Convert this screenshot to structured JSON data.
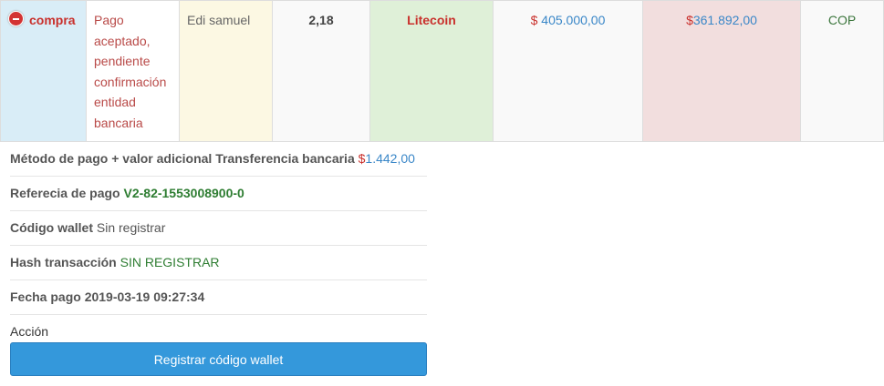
{
  "order": {
    "type": "compra",
    "status": "Pago aceptado, pendiente confirmación entidad bancaria",
    "user": "Edi samuel",
    "amount": "2,18",
    "coin": "Litecoin",
    "price_symbol": "$",
    "price_value": " 405.000,00",
    "total_symbol": "$",
    "total_value": "361.892,00",
    "currency": "COP"
  },
  "details": {
    "payment_method_label": "Método de pago + valor adicional Transferencia bancaria",
    "payment_method_symbol": "$",
    "payment_method_value": "1.442,00",
    "reference_label": "Referecia de pago",
    "reference_value": "V2-82-1553008900-0",
    "wallet_label": "Código wallet",
    "wallet_value": "Sin registrar",
    "hash_label": "Hash transacción",
    "hash_value": "SIN REGISTRAR",
    "date_label": "Fecha pago",
    "date_value": "2019-03-19 09:27:34",
    "action_label": "Acción",
    "register_button": "Registrar código wallet"
  },
  "colors": {
    "accent_blue": "#3498db",
    "type_cell": "#d9edf7",
    "coin_cell": "#dff0d8",
    "total_cell": "#f2dede",
    "user_cell": "#fcf8e3"
  },
  "icons": {
    "collapse": "minus-circle-icon"
  }
}
